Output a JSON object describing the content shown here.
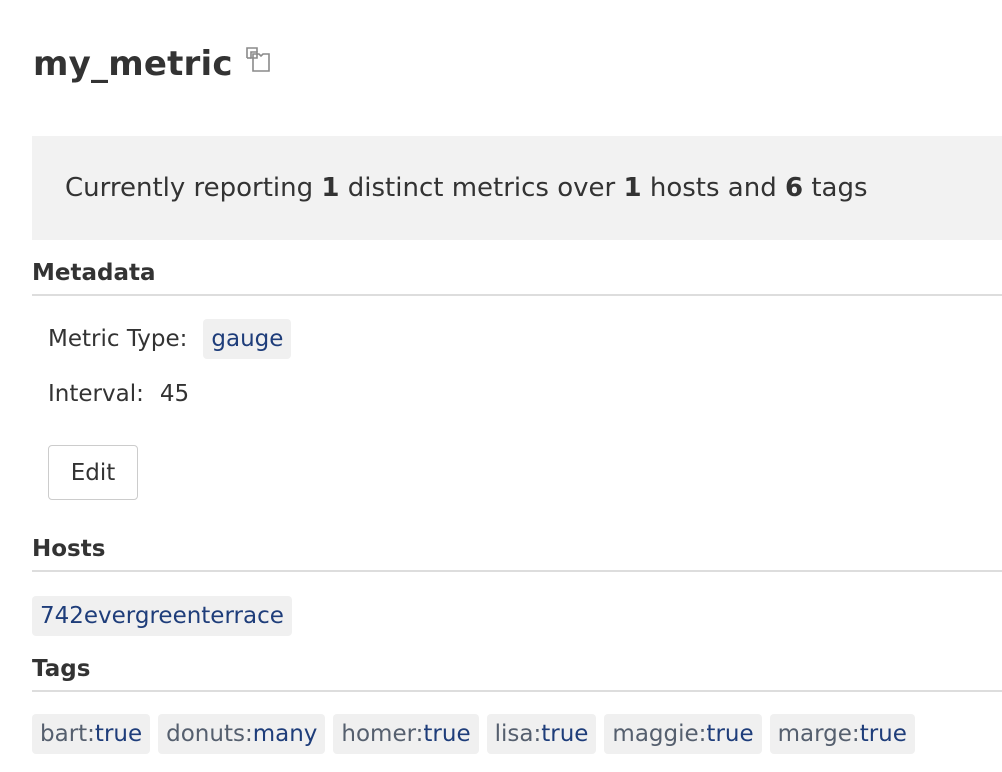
{
  "header": {
    "title": "my_metric",
    "copy_icon": "copy-icon"
  },
  "summary": {
    "prefix": "Currently reporting ",
    "metrics_count": "1",
    "metrics_text": " distinct metrics over ",
    "hosts_count": "1",
    "hosts_text": " hosts and ",
    "tags_count": "6",
    "tags_text": " tags"
  },
  "metadata": {
    "heading": "Metadata",
    "metric_type_label": "Metric Type:",
    "metric_type_value": "gauge",
    "interval_label": "Interval:",
    "interval_value": "45",
    "edit_label": "Edit"
  },
  "hosts": {
    "heading": "Hosts",
    "items": [
      "742evergreenterrace"
    ]
  },
  "tags": {
    "heading": "Tags",
    "items": [
      {
        "key": "bart:",
        "value": "true"
      },
      {
        "key": "donuts:",
        "value": "many"
      },
      {
        "key": "homer:",
        "value": "true"
      },
      {
        "key": "lisa:",
        "value": "true"
      },
      {
        "key": "maggie:",
        "value": "true"
      },
      {
        "key": "marge:",
        "value": "true"
      }
    ]
  },
  "colors": {
    "link": "#1e3d7a",
    "tag_key": "#555f6e",
    "pill_bg": "#f0f0f0",
    "summary_bg": "#f2f2f2"
  }
}
